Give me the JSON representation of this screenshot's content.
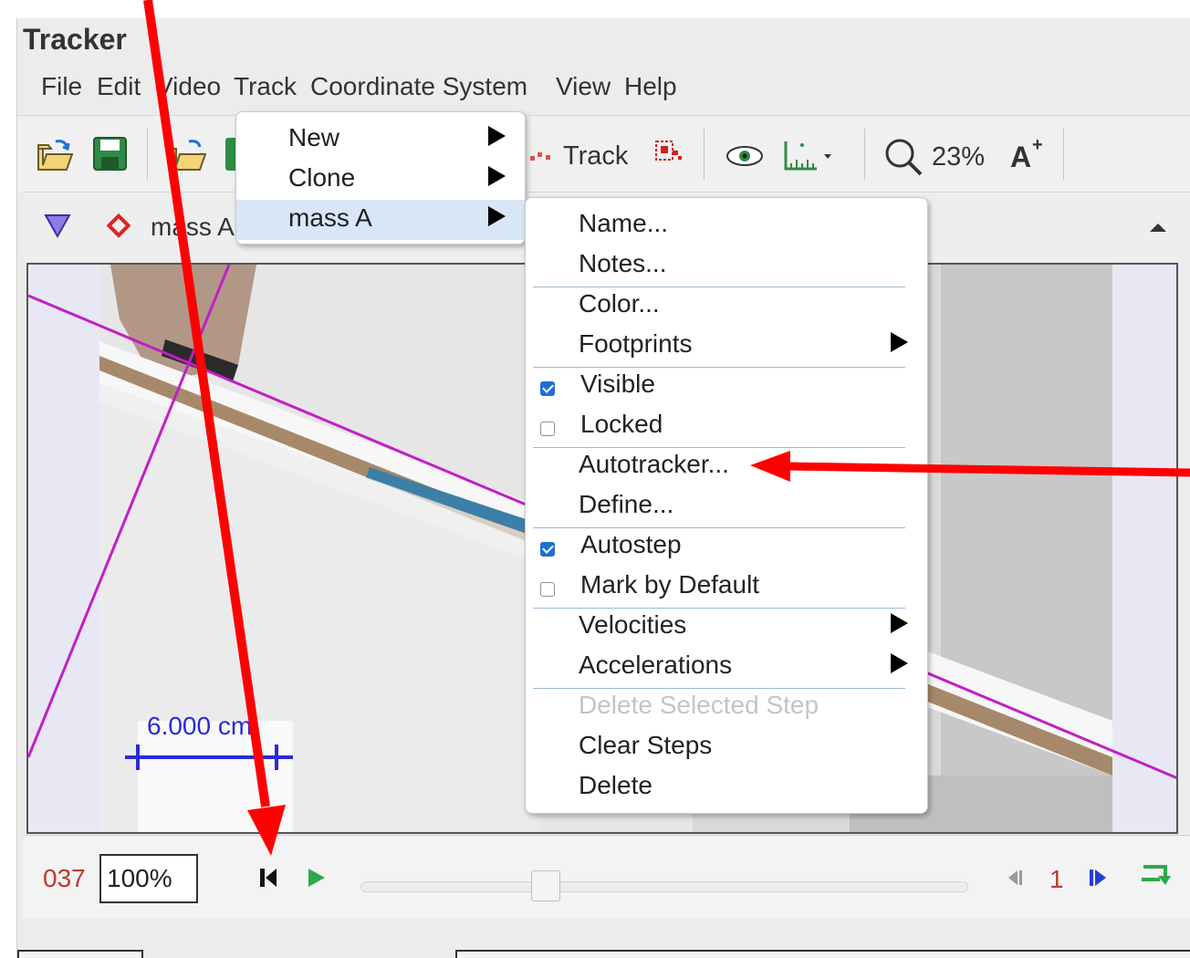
{
  "window": {
    "title": "Tracker"
  },
  "menubar": {
    "items": [
      "File",
      "Edit",
      "Video",
      "Track",
      "Coordinate System",
      "View",
      "Help"
    ]
  },
  "toolbar": {
    "track_button_label": "Track",
    "zoom_label": "23%",
    "icons": [
      "open-folder-icon",
      "save-icon",
      "open-video-icon",
      "track-points-icon",
      "footprint-icon",
      "eye-icon",
      "ruler-icon",
      "magnifier-icon",
      "font-size-icon"
    ]
  },
  "trackbar": {
    "selected_track": "mass A"
  },
  "video": {
    "calibration_label": "6.000 cm"
  },
  "player": {
    "frame_number": "037",
    "rate": "100%",
    "step_number": "1"
  },
  "track_menu": {
    "items": [
      {
        "label": "New",
        "has_submenu": true
      },
      {
        "label": "Clone",
        "has_submenu": true
      },
      {
        "label": "mass A",
        "has_submenu": true,
        "selected": true
      }
    ]
  },
  "mass_menu": {
    "items": [
      {
        "label": "Name..."
      },
      {
        "label": "Notes..."
      },
      {
        "label": "Color..."
      },
      {
        "label": "Footprints",
        "has_submenu": true
      },
      {
        "label": "Visible",
        "checkbox": true,
        "checked": true
      },
      {
        "label": "Locked",
        "checkbox": true,
        "checked": false
      },
      {
        "label": "Autotracker..."
      },
      {
        "label": "Define..."
      },
      {
        "label": "Autostep",
        "checkbox": true,
        "checked": true
      },
      {
        "label": "Mark by Default",
        "checkbox": true,
        "checked": false
      },
      {
        "label": "Velocities",
        "has_submenu": true
      },
      {
        "label": "Accelerations",
        "has_submenu": true
      },
      {
        "label": "Delete Selected Step",
        "disabled": true
      },
      {
        "label": "Clear Steps"
      },
      {
        "label": "Delete"
      }
    ]
  },
  "colors": {
    "accent_blue": "#1f6fd6",
    "annotation_red": "#ff0000",
    "axes_magenta": "#c21ec9",
    "calibration_blue": "#2a2ad8",
    "frame_red": "#c0392b"
  }
}
